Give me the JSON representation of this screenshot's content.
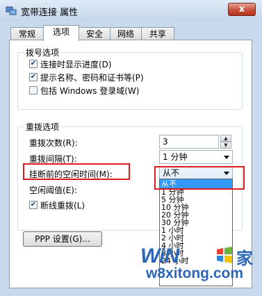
{
  "window": {
    "title": "宽带连接 属性",
    "close_label": "x"
  },
  "tabs": [
    {
      "label": "常规"
    },
    {
      "label": "选项"
    },
    {
      "label": "安全"
    },
    {
      "label": "网络"
    },
    {
      "label": "共享"
    }
  ],
  "dial_options": {
    "title": "拨号选项",
    "items": [
      {
        "label": "连接时显示进度(D)",
        "checked": true
      },
      {
        "label": "提示名称、密码和证书等(P)",
        "checked": true
      },
      {
        "label": "包括 Windows 登录域(W)",
        "checked": false
      }
    ]
  },
  "redial_options": {
    "title": "重拨选项",
    "redial_attempts_label": "重拨次数(R):",
    "redial_attempts_value": "3",
    "redial_interval_label": "重拨间隔(T):",
    "redial_interval_value": "1 分钟",
    "idle_hangup_label": "挂断前的空闲时间(M):",
    "idle_hangup_value": "从不",
    "idle_threshold_label": "空闲阈值(E):",
    "redial_on_drop_label": "断线重拨(L)",
    "redial_on_drop_checked": true
  },
  "ppp_button_label": "PPP 设置(G)...",
  "dropdown_options": [
    "从不",
    "1 分钟",
    "5 分钟",
    "10 分钟",
    "20 分钟",
    "30 分钟",
    "1 小时",
    "2 小时",
    "4 小时",
    "8 小时",
    "24 小时"
  ],
  "watermark": {
    "logo": "WiN",
    "logo_suffix": "家",
    "site": "w8xitong.com"
  },
  "colors": {
    "highlight": "#3399ff",
    "annotation": "#e0191f",
    "brand": "#2b66b8"
  }
}
